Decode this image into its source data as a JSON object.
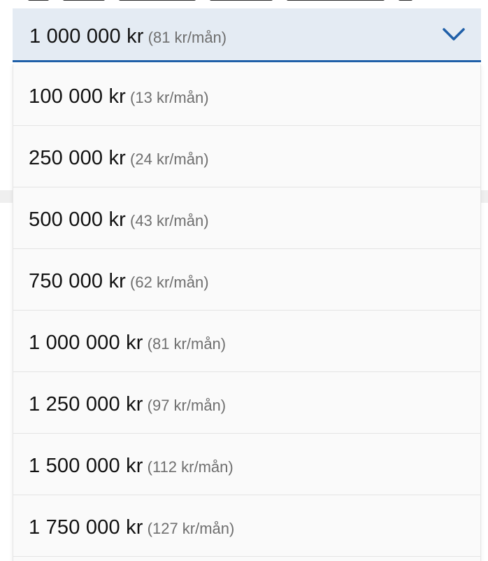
{
  "select": {
    "selected_amount": "1 000 000 kr",
    "selected_monthly": "(81 kr/mån)",
    "icon": "chevron-down-icon",
    "accent_color": "#1f5fa8",
    "trigger_background": "#e4ebf3"
  },
  "options": [
    {
      "amount": "100 000 kr",
      "monthly": "(13 kr/mån)"
    },
    {
      "amount": "250 000 kr",
      "monthly": "(24 kr/mån)"
    },
    {
      "amount": "500 000 kr",
      "monthly": "(43 kr/mån)"
    },
    {
      "amount": "750 000 kr",
      "monthly": "(62 kr/mån)"
    },
    {
      "amount": "1 000 000 kr",
      "monthly": "(81 kr/mån)"
    },
    {
      "amount": "1 250 000 kr",
      "monthly": "(97 kr/mån)"
    },
    {
      "amount": "1 500 000 kr",
      "monthly": "(112 kr/mån)"
    },
    {
      "amount": "1 750 000 kr",
      "monthly": "(127 kr/mån)"
    }
  ]
}
